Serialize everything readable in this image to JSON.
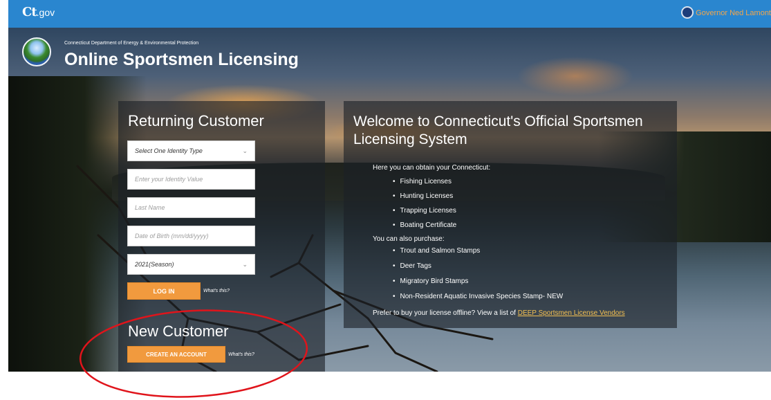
{
  "topbar": {
    "logo_main": "Ct",
    "logo_suffix": ".gov",
    "governor_link": "Governor Ned Lamont",
    "governor_seal_icon": "seal-icon"
  },
  "header": {
    "agency": "Connecticut Department of Energy & Environmental Protection",
    "title": "Online Sportsmen Licensing",
    "logo_icon": "deep-logo-icon"
  },
  "returning": {
    "heading": "Returning Customer",
    "identity_type": "Select One Identity Type",
    "identity_value_placeholder": "Enter your Identity Value",
    "last_name_placeholder": "Last Name",
    "dob_placeholder": "Date of Birth (mm/dd/yyyy)",
    "season": "2021(Season)",
    "login_label": "LOG IN",
    "whats_this": "What's this?"
  },
  "new_customer": {
    "heading": "New Customer",
    "create_label": "CREATE AN ACCOUNT",
    "whats_this": "What's this?"
  },
  "welcome": {
    "heading": "Welcome to Connecticut's Official Sportsmen Licensing System",
    "intro": "Here you can obtain your Connecticut:",
    "licenses": [
      "Fishing Licenses",
      "Hunting Licenses",
      "Trapping Licenses",
      "Boating Certificate"
    ],
    "also": "You can also purchase:",
    "purchases": [
      "Trout and Salmon Stamps",
      "Deer Tags",
      "Migratory Bird Stamps",
      "Non-Resident Aquatic Invasive Species Stamp- NEW"
    ],
    "offline_text": "Prefer to buy your license offline? View a list of",
    "vendor_link": "DEEP Sportsmen License Vendors"
  },
  "colors": {
    "topbar": "#2a86cf",
    "button": "#f19a3e",
    "link": "#f4c052",
    "annotation": "#e0141b"
  }
}
